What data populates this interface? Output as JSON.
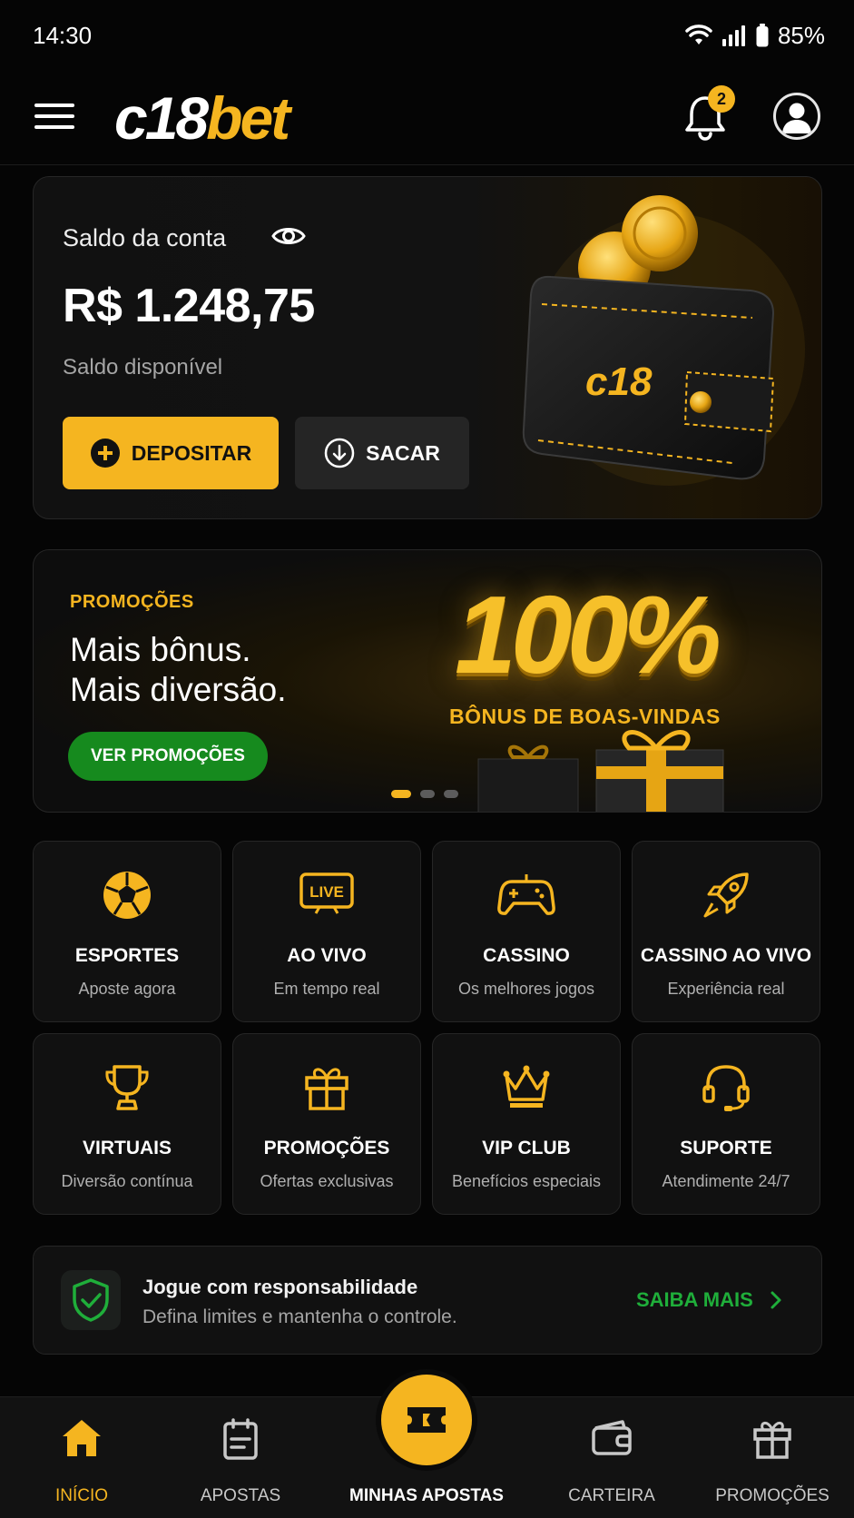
{
  "status_bar": {
    "time": "14:30",
    "battery": "85%"
  },
  "header": {
    "logo_part1": "c18",
    "logo_part2": "bet",
    "notifications_count": "2",
    "icons": [
      "menu-icon",
      "bell-icon",
      "user-icon"
    ]
  },
  "balance": {
    "label": "Saldo da conta",
    "amount": "R$ 1.248,75",
    "sub": "Saldo disponível",
    "deposit_label": "DEPOSITAR",
    "withdraw_label": "SACAR",
    "wallet_logo": "c18"
  },
  "promo": {
    "tag": "PROMOÇÕES",
    "title_line1": "Mais bônus.",
    "title_line2": "Mais diversão.",
    "button": "VER PROMOÇÕES",
    "big_text": "100%",
    "sub_text": "BÔNUS DE BOAS-VINDAS",
    "slides": 3,
    "active_slide": 1
  },
  "tiles": [
    {
      "title": "ESPORTES",
      "sub": "Aposte agora",
      "icon": "soccer-ball-icon"
    },
    {
      "title": "AO VIVO",
      "sub": "Em tempo real",
      "icon": "live-tv-icon",
      "icon_text": "LIVE"
    },
    {
      "title": "CASSINO",
      "sub": "Os melhores jogos",
      "icon": "gamepad-icon"
    },
    {
      "title": "CASSINO AO VIVO",
      "sub": "Experiência real",
      "icon": "rocket-icon"
    },
    {
      "title": "VIRTUAIS",
      "sub": "Diversão contínua",
      "icon": "trophy-icon"
    },
    {
      "title": "PROMOÇÕES",
      "sub": "Ofertas exclusivas",
      "icon": "gift-icon"
    },
    {
      "title": "VIP CLUB",
      "sub": "Benefícios especiais",
      "icon": "crown-icon"
    },
    {
      "title": "SUPORTE",
      "sub": "Atendimente 24/7",
      "icon": "headset-icon"
    }
  ],
  "responsible": {
    "title": "Jogue com responsabilidade",
    "text": "Defina limites e mantenha o controle.",
    "link": "SAIBA MAIS"
  },
  "nav": {
    "items": [
      {
        "label": "INÍCIO",
        "icon": "home-icon",
        "active": true
      },
      {
        "label": "APOSTAS",
        "icon": "betslip-icon"
      },
      {
        "label": "MINHAS APOSTAS",
        "icon": "ticket-icon"
      },
      {
        "label": "CARTEIRA",
        "icon": "wallet-icon"
      },
      {
        "label": "PROMOÇÕES",
        "icon": "gift-icon"
      }
    ]
  },
  "colors": {
    "accent": "#f5b520",
    "green": "#1fae3a",
    "background": "#050505",
    "card": "#111111"
  }
}
